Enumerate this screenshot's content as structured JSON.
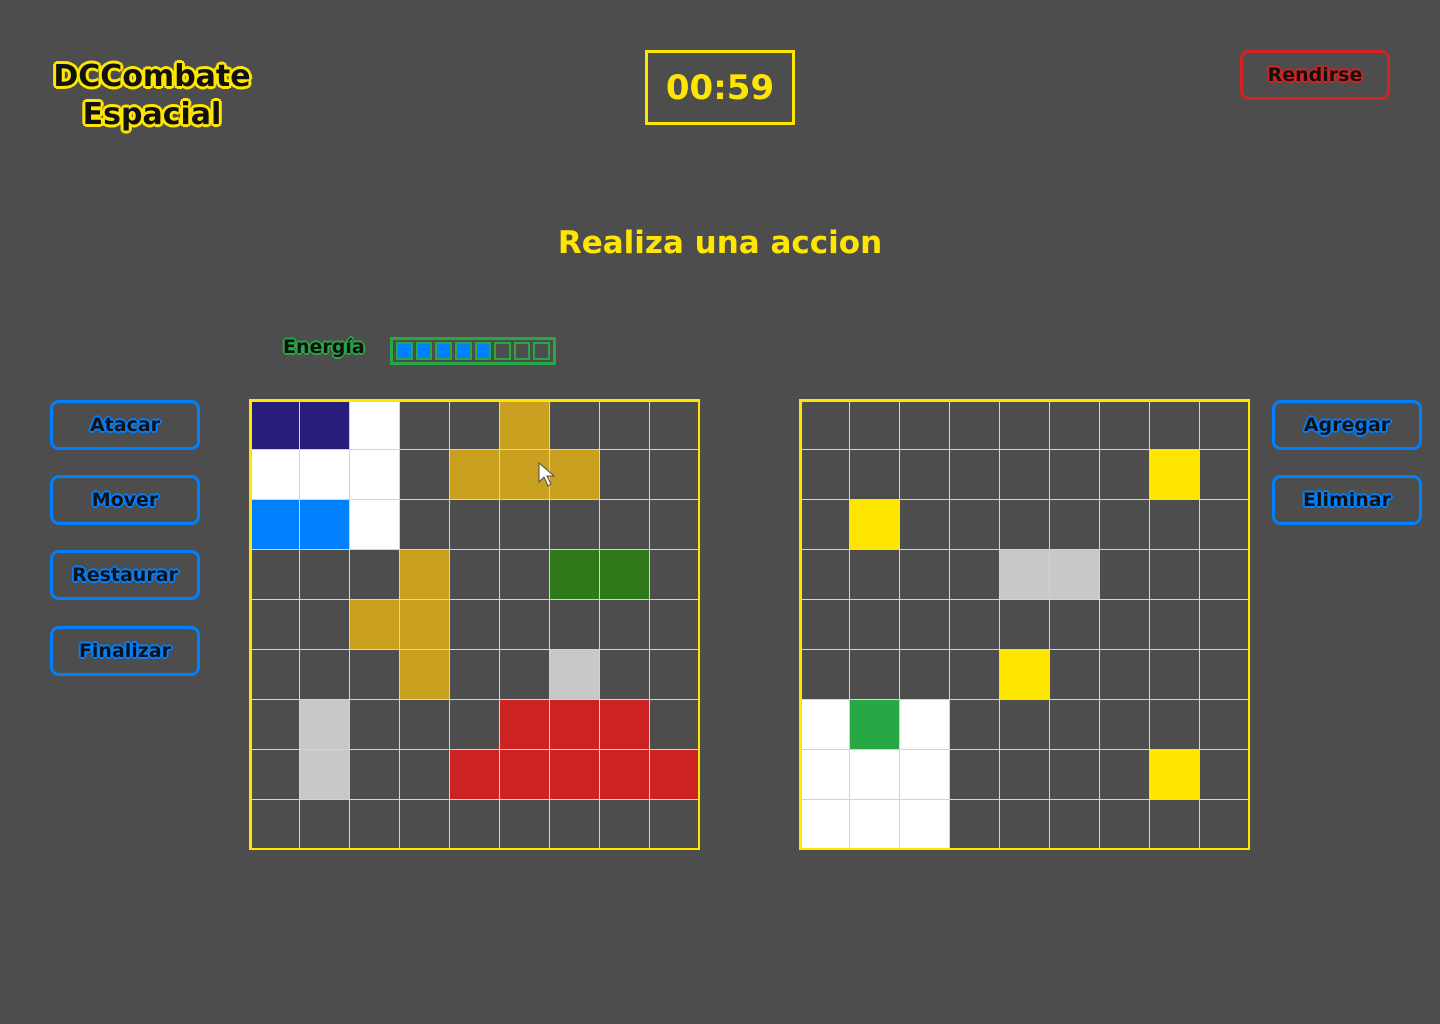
{
  "logo": {
    "line1": "DCCombate",
    "line2": "Espacial"
  },
  "timer": {
    "value": "00:59"
  },
  "header": {
    "surrender_label": "Rendirse"
  },
  "status": {
    "message": "Realiza una accion"
  },
  "energy": {
    "label": "Energía",
    "level": 5,
    "max": 8,
    "fill_color": "#0080ff",
    "border_color": "#28a745"
  },
  "left_actions": [
    {
      "label": "Atacar"
    },
    {
      "label": "Mover"
    },
    {
      "label": "Restaurar"
    },
    {
      "label": "Finalizar"
    }
  ],
  "right_actions": [
    {
      "label": "Agregar"
    },
    {
      "label": "Eliminar"
    }
  ],
  "colors": {
    "background": "#4d4d4d",
    "grid_line": "#ffe600",
    "navy": "#261e7a",
    "white": "#ffffff",
    "blue": "#0080ff",
    "gold": "#c9a020",
    "green_dark": "#2e7a1a",
    "green": "#28a745",
    "gray": "#c8c8c8",
    "red": "#cc2222",
    "yellow": "#ffe600"
  },
  "grids": {
    "player": [
      [
        "navy",
        "navy",
        "white",
        "",
        "",
        "gold",
        "",
        "",
        ""
      ],
      [
        "white",
        "white",
        "white",
        "",
        "gold",
        "gold",
        "gold",
        "",
        ""
      ],
      [
        "blue",
        "blue",
        "white",
        "",
        "",
        "",
        "",
        "",
        ""
      ],
      [
        "",
        "",
        "",
        "gold",
        "",
        "",
        "green_dark",
        "green_dark",
        ""
      ],
      [
        "",
        "",
        "gold",
        "gold",
        "",
        "",
        "",
        "",
        ""
      ],
      [
        "",
        "",
        "",
        "gold",
        "",
        "",
        "gray",
        "",
        ""
      ],
      [
        "",
        "gray",
        "",
        "",
        "",
        "red",
        "red",
        "red",
        ""
      ],
      [
        "",
        "gray",
        "",
        "",
        "red",
        "red",
        "red",
        "red",
        "red"
      ],
      [
        "",
        "",
        "",
        "",
        "",
        "",
        "",
        "",
        ""
      ]
    ],
    "enemy": [
      [
        "",
        "",
        "",
        "",
        "",
        "",
        "",
        "",
        ""
      ],
      [
        "",
        "",
        "",
        "",
        "",
        "",
        "",
        "yellow",
        ""
      ],
      [
        "",
        "yellow",
        "",
        "",
        "",
        "",
        "",
        "",
        ""
      ],
      [
        "",
        "",
        "",
        "",
        "gray",
        "gray",
        "",
        "",
        ""
      ],
      [
        "",
        "",
        "",
        "",
        "",
        "",
        "",
        "",
        ""
      ],
      [
        "",
        "",
        "",
        "",
        "yellow",
        "",
        "",
        "",
        ""
      ],
      [
        "white",
        "green",
        "white",
        "",
        "",
        "",
        "",
        "",
        ""
      ],
      [
        "white",
        "white",
        "white",
        "",
        "",
        "",
        "",
        "yellow",
        ""
      ],
      [
        "white",
        "white",
        "white",
        "",
        "",
        "",
        "",
        "",
        ""
      ]
    ]
  }
}
